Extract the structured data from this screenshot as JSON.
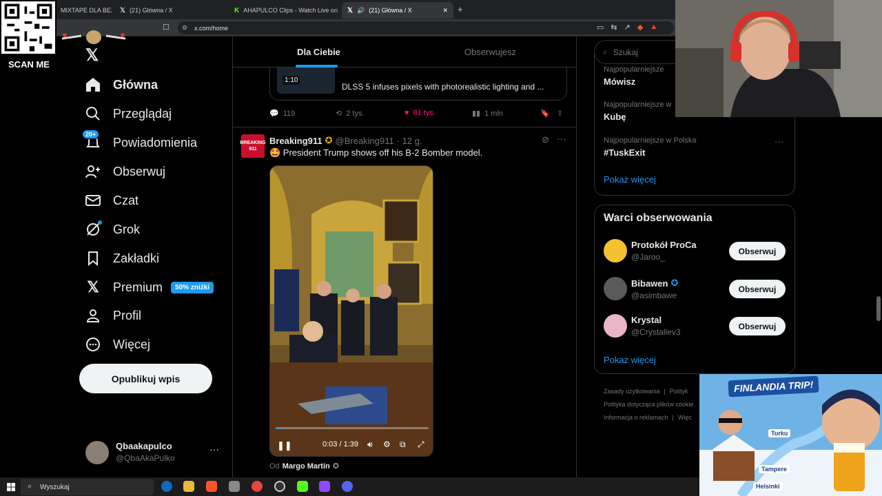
{
  "browser": {
    "tabs": [
      {
        "label": "MIXTAPE DLA BEZRO"
      },
      {
        "label": "(21) Główna / X"
      },
      {
        "label": "AHAPULCO Clips - Watch Live on Kic"
      },
      {
        "label": "(21) Główna / X"
      }
    ],
    "url": "x.com/home"
  },
  "overlay": {
    "scan_me": "SCAN ME"
  },
  "sidebar": {
    "items": [
      {
        "label": "Główna",
        "icon": "home-icon"
      },
      {
        "label": "Przeglądaj",
        "icon": "search-icon"
      },
      {
        "label": "Powiadomienia",
        "icon": "bell-icon",
        "badge": "20+"
      },
      {
        "label": "Obserwuj",
        "icon": "follow-icon"
      },
      {
        "label": "Czat",
        "icon": "mail-icon"
      },
      {
        "label": "Grok",
        "icon": "grok-icon"
      },
      {
        "label": "Zakładki",
        "icon": "bookmark-icon"
      },
      {
        "label": "Premium",
        "icon": "x-logo-icon",
        "badge": "50% zniżki"
      },
      {
        "label": "Profil",
        "icon": "person-icon"
      },
      {
        "label": "Więcej",
        "icon": "more-icon"
      }
    ],
    "post_button": "Opublikuj wpis",
    "account": {
      "name": "Qbaakapulco",
      "handle": "@QbaAkaPulko",
      "more": "···"
    }
  },
  "feed": {
    "tabs": [
      "Dla Ciebie",
      "Obserwujesz"
    ],
    "prev_tweet": {
      "video_duration": "1:10",
      "card_text": "DLSS 5 infuses pixels with photorealistic lighting and ...",
      "replies": "119",
      "retweets": "2 tys.",
      "likes": "81 tys.",
      "views": "1 mln"
    },
    "tweet": {
      "avatar_text": "BREAKING 911",
      "name": "Breaking911",
      "handle": "@Breaking911",
      "time": "· 12 g.",
      "text": "🤩 President Trump shows off his B-2 Bomber model.",
      "video_time": "0:03 / 1:39",
      "video_progress": 0.03,
      "from_label": "Od",
      "from_name": "Margo Martin"
    }
  },
  "right": {
    "search_placeholder": "Szukaj",
    "trends": [
      {
        "sub": "Najpopularniejsze",
        "title": "Mówisz"
      },
      {
        "sub": "Najpopularniejsze w",
        "title": "Kubę"
      },
      {
        "sub": "Najpopularniejsze w Polska",
        "title": "#TuskExit"
      }
    ],
    "show_more": "Pokaż więcej",
    "who_to_follow": {
      "title": "Warci obserwowania",
      "users": [
        {
          "name": "Protokół ProCa",
          "handle": "@Jaroo_",
          "button": "Obserwuj"
        },
        {
          "name": "Bibawen",
          "handle": "@asimbawe",
          "button": "Obserwuj"
        },
        {
          "name": "Krystal",
          "handle": "@Crystallev3",
          "button": "Obserwuj"
        }
      ],
      "show_more": "Pokaż więcej"
    },
    "footer": [
      "Zasady użytkowania",
      "Polityk",
      "Polityka dotycząca plików cookie",
      "Informacja o reklamach",
      "Więc"
    ]
  },
  "promo": {
    "title": "FINLANDIA TRIP!",
    "cities": [
      "Turku",
      "Tampere",
      "Helsinki"
    ]
  },
  "taskbar": {
    "search": "Wyszukaj"
  },
  "colors": {
    "accent": "#1d9bf0",
    "like": "#f91880",
    "bg": "#000000",
    "border": "#2f3336"
  }
}
